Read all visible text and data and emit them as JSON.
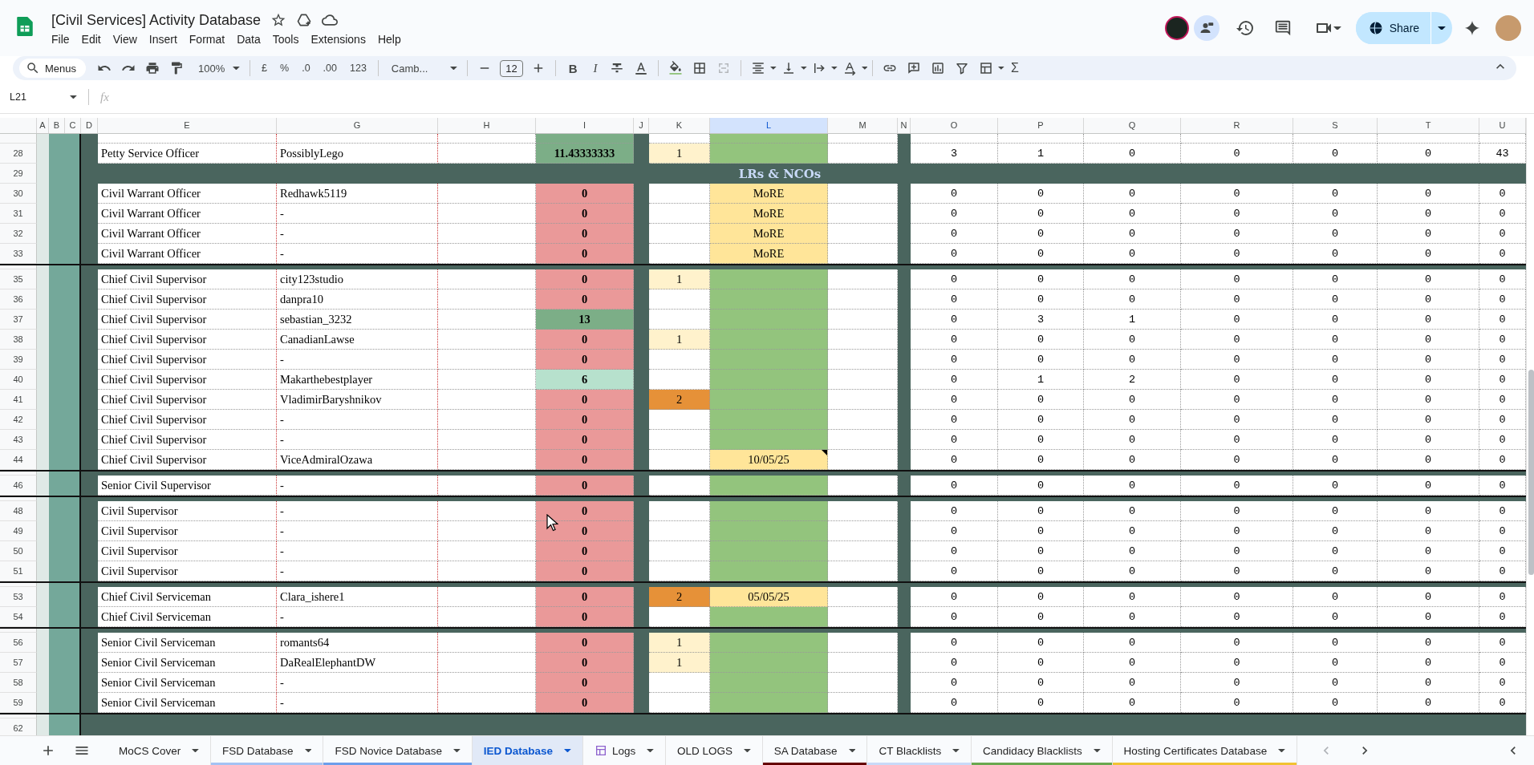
{
  "document": {
    "title": "[Civil Services] Activity Database"
  },
  "menu": [
    "File",
    "Edit",
    "View",
    "Insert",
    "Format",
    "Data",
    "Tools",
    "Extensions",
    "Help"
  ],
  "share": {
    "label": "Share"
  },
  "toolbar": {
    "search": "Menus",
    "zoom": "100%",
    "number_formats": [
      "£",
      "%",
      ".0",
      ".00",
      "123"
    ],
    "font": "Camb...",
    "font_size": "12",
    "bold": "B",
    "italic": "I",
    "sum": "Σ"
  },
  "formula_bar": {
    "cell": "L21",
    "fx": "fx"
  },
  "columns": [
    {
      "label": "A",
      "selected": false
    },
    {
      "label": "B",
      "selected": false
    },
    {
      "label": "C",
      "selected": false
    },
    {
      "label": "D",
      "selected": false
    },
    {
      "label": "E",
      "selected": false
    },
    {
      "label": "G",
      "selected": false
    },
    {
      "label": "H",
      "selected": false
    },
    {
      "label": "I",
      "selected": false
    },
    {
      "label": "J",
      "selected": false
    },
    {
      "label": "K",
      "selected": false
    },
    {
      "label": "L",
      "selected": true
    },
    {
      "label": "M",
      "selected": false
    },
    {
      "label": "N",
      "selected": false
    },
    {
      "label": "O",
      "selected": false
    },
    {
      "label": "P",
      "selected": false
    },
    {
      "label": "Q",
      "selected": false
    },
    {
      "label": "R",
      "selected": false
    },
    {
      "label": "S",
      "selected": false
    },
    {
      "label": "T",
      "selected": false
    },
    {
      "label": "U",
      "selected": false
    }
  ],
  "rows": [
    {
      "kind": "cut"
    },
    {
      "kind": "data",
      "number": "28",
      "rank": "Petty Service Officer",
      "member": "PossiblyLego",
      "column_i": {
        "text": "11.43333333",
        "color": "#7cae87"
      },
      "column_k": {
        "text": "1",
        "color": "#fff2cc"
      },
      "column_l": {
        "color": "#93c47d"
      },
      "columns_o_to_u": [
        "3",
        "1",
        "0",
        "0",
        "0",
        "0",
        "43"
      ]
    },
    {
      "kind": "section",
      "number": "29",
      "title": "LRs & NCOs"
    },
    {
      "kind": "data",
      "number": "30",
      "rank": "Civil Warrant Officer",
      "member": "Redhawk5119",
      "column_i": {
        "text": "0",
        "color": "#ea9999"
      },
      "column_l": {
        "text": "MoRE",
        "color": "#ffe599"
      },
      "columns_o_to_u": [
        "0",
        "0",
        "0",
        "0",
        "0",
        "0",
        "0"
      ]
    },
    {
      "kind": "data",
      "number": "31",
      "rank": "Civil Warrant Officer",
      "member": "-",
      "column_i": {
        "text": "0",
        "color": "#ea9999"
      },
      "column_l": {
        "text": "MoRE",
        "color": "#ffe599"
      },
      "columns_o_to_u": [
        "0",
        "0",
        "0",
        "0",
        "0",
        "0",
        "0"
      ]
    },
    {
      "kind": "data",
      "number": "32",
      "rank": "Civil Warrant Officer",
      "member": "-",
      "column_i": {
        "text": "0",
        "color": "#ea9999"
      },
      "column_l": {
        "text": "MoRE",
        "color": "#ffe599"
      },
      "columns_o_to_u": [
        "0",
        "0",
        "0",
        "0",
        "0",
        "0",
        "0"
      ]
    },
    {
      "kind": "data",
      "number": "33",
      "rank": "Civil Warrant Officer",
      "member": "-",
      "column_i": {
        "text": "0",
        "color": "#ea9999"
      },
      "column_l": {
        "text": "MoRE",
        "color": "#ffe599"
      },
      "columns_o_to_u": [
        "0",
        "0",
        "0",
        "0",
        "0",
        "0",
        "0"
      ]
    },
    {
      "kind": "gap"
    },
    {
      "kind": "data",
      "number": "35",
      "rank": "Chief Civil Supervisor",
      "member": "city123studio",
      "column_i": {
        "text": "0",
        "color": "#ea9999"
      },
      "column_k": {
        "text": "1",
        "color": "#fff2cc"
      },
      "column_l": {
        "color": "#93c47d"
      },
      "columns_o_to_u": [
        "0",
        "0",
        "0",
        "0",
        "0",
        "0",
        "0"
      ]
    },
    {
      "kind": "data",
      "number": "36",
      "rank": "Chief Civil Supervisor",
      "member": "danpra10",
      "column_i": {
        "text": "0",
        "color": "#ea9999"
      },
      "column_l": {
        "color": "#93c47d"
      },
      "columns_o_to_u": [
        "0",
        "0",
        "0",
        "0",
        "0",
        "0",
        "0"
      ]
    },
    {
      "kind": "data",
      "number": "37",
      "rank": "Chief Civil Supervisor",
      "member": "sebastian_3232",
      "column_i": {
        "text": "13",
        "color": "#7cae87"
      },
      "column_l": {
        "color": "#93c47d"
      },
      "columns_o_to_u": [
        "0",
        "3",
        "1",
        "0",
        "0",
        "0",
        "0"
      ]
    },
    {
      "kind": "data",
      "number": "38",
      "rank": "Chief Civil Supervisor",
      "member": "CanadianLawse",
      "column_i": {
        "text": "0",
        "color": "#ea9999"
      },
      "column_k": {
        "text": "1",
        "color": "#fff2cc"
      },
      "column_l": {
        "color": "#93c47d"
      },
      "columns_o_to_u": [
        "0",
        "0",
        "0",
        "0",
        "0",
        "0",
        "0"
      ]
    },
    {
      "kind": "data",
      "number": "39",
      "rank": "Chief Civil Supervisor",
      "member": "-",
      "column_i": {
        "text": "0",
        "color": "#ea9999"
      },
      "column_l": {
        "color": "#93c47d"
      },
      "columns_o_to_u": [
        "0",
        "0",
        "0",
        "0",
        "0",
        "0",
        "0"
      ]
    },
    {
      "kind": "data",
      "number": "40",
      "rank": "Chief Civil Supervisor",
      "member": "Makarthebestplayer",
      "column_i": {
        "text": "6",
        "color": "#b7e1cd"
      },
      "column_l": {
        "color": "#93c47d"
      },
      "columns_o_to_u": [
        "0",
        "1",
        "2",
        "0",
        "0",
        "0",
        "0"
      ]
    },
    {
      "kind": "data",
      "number": "41",
      "rank": "Chief Civil Supervisor",
      "member": "VladimirBaryshnikov",
      "column_i": {
        "text": "0",
        "color": "#ea9999"
      },
      "column_k": {
        "text": "2",
        "color": "#e69138"
      },
      "column_l": {
        "color": "#93c47d"
      },
      "columns_o_to_u": [
        "0",
        "0",
        "0",
        "0",
        "0",
        "0",
        "0"
      ]
    },
    {
      "kind": "data",
      "number": "42",
      "rank": "Chief Civil Supervisor",
      "member": "-",
      "column_i": {
        "text": "0",
        "color": "#ea9999"
      },
      "column_l": {
        "color": "#93c47d"
      },
      "columns_o_to_u": [
        "0",
        "0",
        "0",
        "0",
        "0",
        "0",
        "0"
      ]
    },
    {
      "kind": "data",
      "number": "43",
      "rank": "Chief Civil Supervisor",
      "member": "-",
      "column_i": {
        "text": "0",
        "color": "#ea9999"
      },
      "column_l": {
        "color": "#93c47d"
      },
      "columns_o_to_u": [
        "0",
        "0",
        "0",
        "0",
        "0",
        "0",
        "0"
      ]
    },
    {
      "kind": "data",
      "number": "44",
      "rank": "Chief Civil Supervisor",
      "member": "ViceAdmiralOzawa",
      "column_i": {
        "text": "0",
        "color": "#ea9999"
      },
      "column_l": {
        "text": "10/05/25",
        "color": "#ffe599",
        "note": true
      },
      "columns_o_to_u": [
        "0",
        "0",
        "0",
        "0",
        "0",
        "0",
        "0"
      ]
    },
    {
      "kind": "gap"
    },
    {
      "kind": "data",
      "number": "46",
      "rank": "Senior Civil Supervisor",
      "member": "-",
      "column_i": {
        "text": "0",
        "color": "#ea9999"
      },
      "column_l": {
        "color": "#93c47d"
      },
      "columns_o_to_u": [
        "0",
        "0",
        "0",
        "0",
        "0",
        "0",
        "0"
      ]
    },
    {
      "kind": "gap"
    },
    {
      "kind": "data",
      "number": "48",
      "rank": "Civil Supervisor",
      "member": "-",
      "column_i": {
        "text": "0",
        "color": "#ea9999"
      },
      "column_l": {
        "color": "#93c47d"
      },
      "columns_o_to_u": [
        "0",
        "0",
        "0",
        "0",
        "0",
        "0",
        "0"
      ]
    },
    {
      "kind": "data",
      "number": "49",
      "rank": "Civil Supervisor",
      "member": "-",
      "column_i": {
        "text": "0",
        "color": "#ea9999"
      },
      "column_l": {
        "color": "#93c47d"
      },
      "columns_o_to_u": [
        "0",
        "0",
        "0",
        "0",
        "0",
        "0",
        "0"
      ]
    },
    {
      "kind": "data",
      "number": "50",
      "rank": "Civil Supervisor",
      "member": "-",
      "column_i": {
        "text": "0",
        "color": "#ea9999"
      },
      "column_l": {
        "color": "#93c47d"
      },
      "columns_o_to_u": [
        "0",
        "0",
        "0",
        "0",
        "0",
        "0",
        "0"
      ]
    },
    {
      "kind": "data",
      "number": "51",
      "rank": "Civil Supervisor",
      "member": "-",
      "column_i": {
        "text": "0",
        "color": "#ea9999"
      },
      "column_l": {
        "color": "#93c47d"
      },
      "columns_o_to_u": [
        "0",
        "0",
        "0",
        "0",
        "0",
        "0",
        "0"
      ]
    },
    {
      "kind": "gap"
    },
    {
      "kind": "data",
      "number": "53",
      "rank": "Chief Civil Serviceman",
      "member": "Clara_ishere1",
      "column_i": {
        "text": "0",
        "color": "#ea9999"
      },
      "column_k": {
        "text": "2",
        "color": "#e69138"
      },
      "column_l": {
        "text": "05/05/25",
        "color": "#ffe599"
      },
      "columns_o_to_u": [
        "0",
        "0",
        "0",
        "0",
        "0",
        "0",
        "0"
      ]
    },
    {
      "kind": "data",
      "number": "54",
      "rank": "Chief Civil Serviceman",
      "member": "-",
      "column_i": {
        "text": "0",
        "color": "#ea9999"
      },
      "column_l": {
        "color": "#93c47d"
      },
      "columns_o_to_u": [
        "0",
        "0",
        "0",
        "0",
        "0",
        "0",
        "0"
      ]
    },
    {
      "kind": "gap"
    },
    {
      "kind": "data",
      "number": "56",
      "rank": "Senior Civil Serviceman",
      "member": "romants64",
      "column_i": {
        "text": "0",
        "color": "#ea9999"
      },
      "column_k": {
        "text": "1",
        "color": "#fff2cc"
      },
      "column_l": {
        "color": "#93c47d"
      },
      "columns_o_to_u": [
        "0",
        "0",
        "0",
        "0",
        "0",
        "0",
        "0"
      ]
    },
    {
      "kind": "data",
      "number": "57",
      "rank": "Senior Civil Serviceman",
      "member": "DaRealElephantDW",
      "column_i": {
        "text": "0",
        "color": "#ea9999"
      },
      "column_k": {
        "text": "1",
        "color": "#fff2cc"
      },
      "column_l": {
        "color": "#93c47d"
      },
      "columns_o_to_u": [
        "0",
        "0",
        "0",
        "0",
        "0",
        "0",
        "0"
      ]
    },
    {
      "kind": "data",
      "number": "58",
      "rank": "Senior Civil Serviceman",
      "member": "-",
      "column_i": {
        "text": "0",
        "color": "#ea9999"
      },
      "column_l": {
        "color": "#93c47d"
      },
      "columns_o_to_u": [
        "0",
        "0",
        "0",
        "0",
        "0",
        "0",
        "0"
      ]
    },
    {
      "kind": "data",
      "number": "59",
      "rank": "Senior Civil Serviceman",
      "member": "-",
      "column_i": {
        "text": "0",
        "color": "#ea9999"
      },
      "column_l": {
        "color": "#93c47d"
      },
      "columns_o_to_u": [
        "0",
        "0",
        "0",
        "0",
        "0",
        "0",
        "0"
      ]
    },
    {
      "kind": "gap"
    },
    {
      "kind": "blank",
      "number": "62"
    }
  ],
  "sheet_tabs": [
    {
      "label": "MoCS Cover",
      "kind": "sheet",
      "selected": false
    },
    {
      "label": "FSD Database",
      "kind": "sheet",
      "selected": false,
      "color": "#a4c2f4"
    },
    {
      "label": "FSD Novice Database",
      "kind": "sheet",
      "selected": false,
      "color": "#6d9eeb"
    },
    {
      "label": "IED Database",
      "kind": "sheet",
      "selected": true
    },
    {
      "label": "Logs",
      "kind": "table",
      "selected": false
    },
    {
      "label": "OLD LOGS",
      "kind": "sheet",
      "selected": false
    },
    {
      "label": "SA Database",
      "kind": "sheet",
      "selected": false,
      "color": "#660000"
    },
    {
      "label": "CT Blacklists",
      "kind": "sheet",
      "selected": false,
      "color": "#c9daf8"
    },
    {
      "label": "Candidacy Blacklists",
      "kind": "sheet",
      "selected": false,
      "color": "#6aa84f"
    },
    {
      "label": "Hosting Certificates Database",
      "kind": "sheet",
      "selected": false,
      "color": "#f1c232"
    }
  ]
}
